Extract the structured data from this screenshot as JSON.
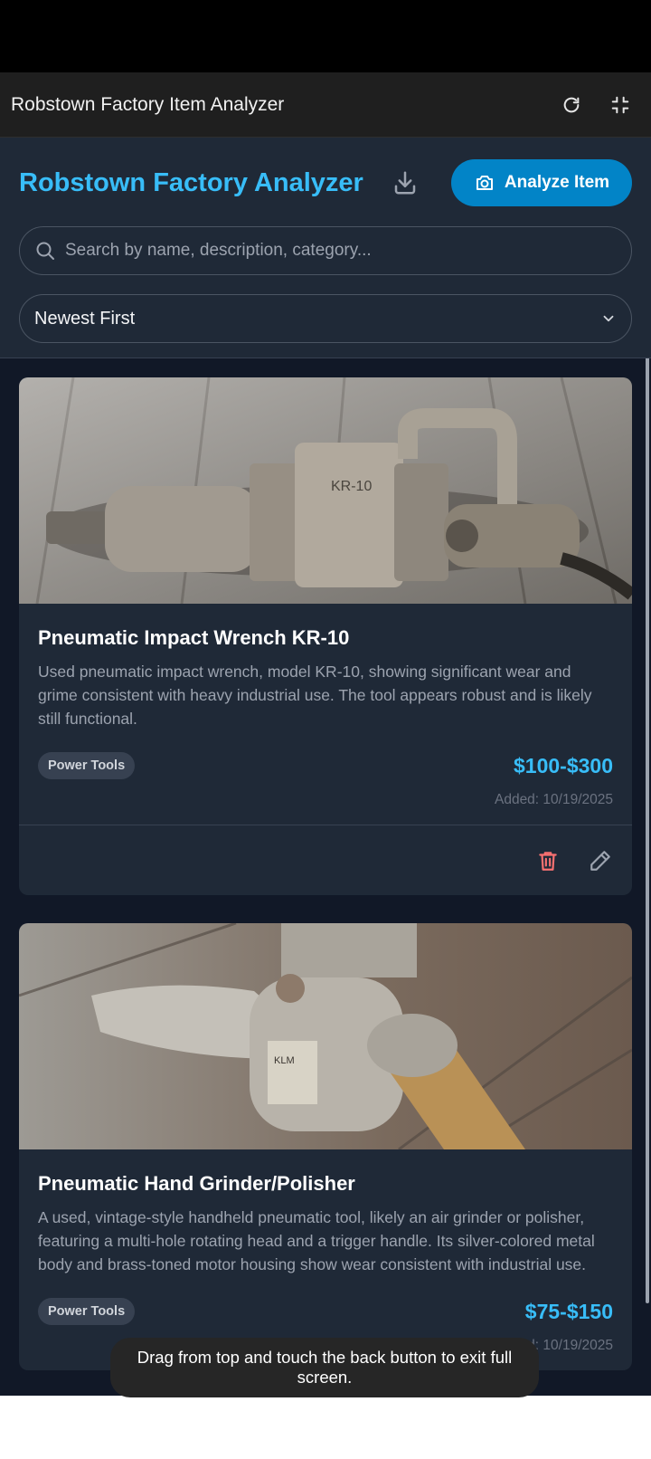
{
  "window": {
    "title": "Robstown Factory Item Analyzer",
    "refresh_icon": "refresh-icon",
    "exit_fullscreen_icon": "exit-fullscreen-icon"
  },
  "header": {
    "title": "Robstown Factory Analyzer",
    "download_icon": "download-icon",
    "analyze_label": "Analyze Item",
    "accent": "#38bdf8",
    "button_color": "#0284c7"
  },
  "search": {
    "placeholder": "Search by name, description, category...",
    "value": ""
  },
  "sort": {
    "selected": "Newest First"
  },
  "items": [
    {
      "title": "Pneumatic Impact Wrench KR-10",
      "description": "Used pneumatic impact wrench, model KR-10, showing significant wear and grime consistent with heavy industrial use. The tool appears robust and is likely still functional.",
      "category": "Power Tools",
      "price": "$100-$300",
      "added": "Added: 10/19/2025"
    },
    {
      "title": "Pneumatic Hand Grinder/Polisher",
      "description": "A used, vintage-style handheld pneumatic tool, likely an air grinder or polisher, featuring a multi-hole rotating head and a trigger handle. Its silver-colored metal body and brass-toned motor housing show wear consistent with industrial use.",
      "category": "Power Tools",
      "price": "$75-$150",
      "added": "Added: 10/19/2025"
    }
  ],
  "toast": {
    "message": "Drag from top and touch the back button to exit full screen."
  }
}
